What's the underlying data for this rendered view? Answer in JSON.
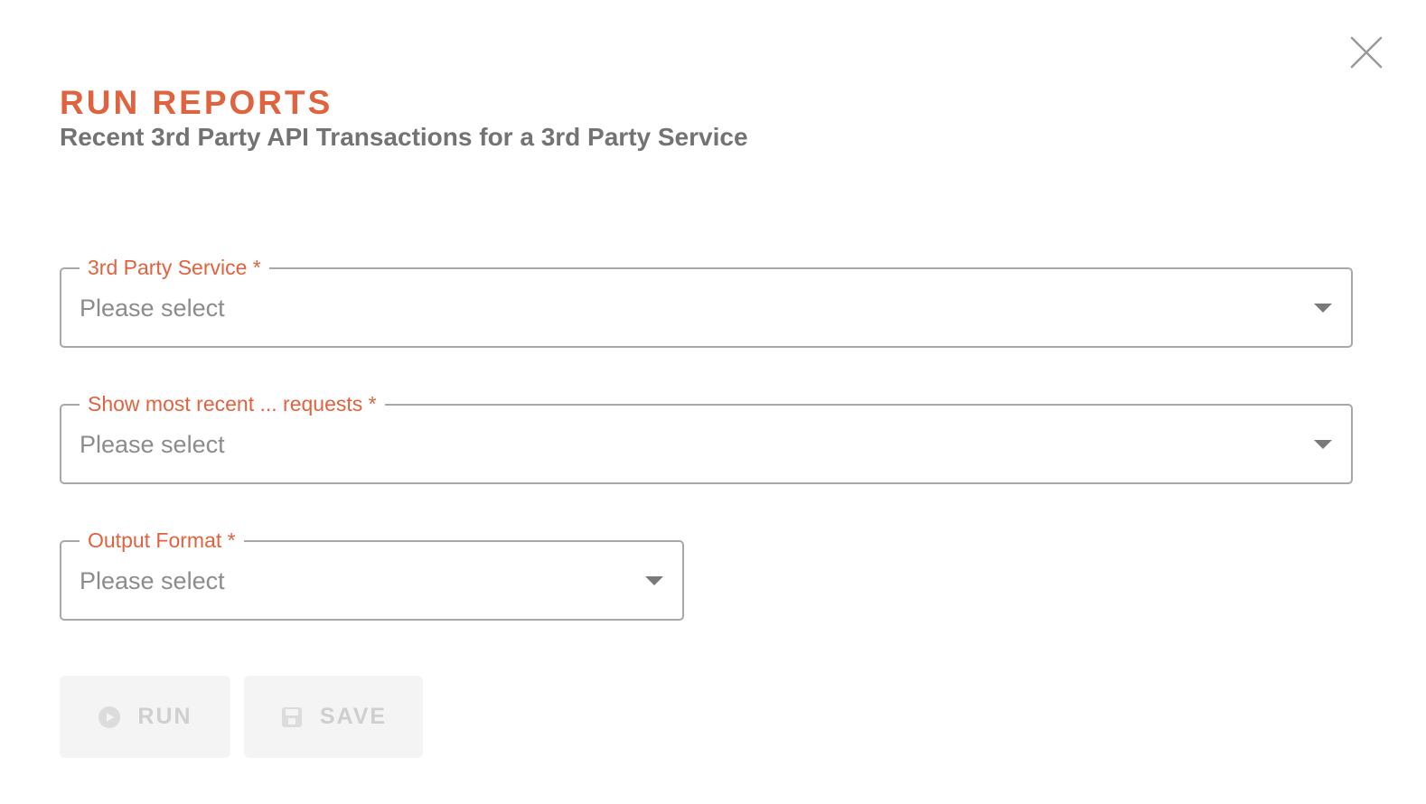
{
  "dialog": {
    "close_icon": "close-icon",
    "title": "RUN REPORTS",
    "subtitle": "Recent 3rd Party API Transactions for a 3rd Party Service"
  },
  "form": {
    "fields": [
      {
        "label": "3rd Party Service *",
        "value": "Please select",
        "icon": "chevron-down-icon"
      },
      {
        "label": "Show most recent ... requests *",
        "value": "Please select",
        "icon": "chevron-down-icon"
      },
      {
        "label": "Output Format *",
        "value": "Please select",
        "icon": "chevron-down-icon"
      }
    ]
  },
  "actions": {
    "run": {
      "label": "RUN",
      "icon": "play-icon",
      "disabled": true
    },
    "save": {
      "label": "SAVE",
      "icon": "save-icon",
      "disabled": true
    }
  },
  "colors": {
    "accent": "#e0633f",
    "subtitle": "#737373",
    "placeholder": "#8c8c8c",
    "border": "#a8a8a8",
    "button_bg": "#f4f4f4",
    "button_disabled_text": "#cfcfcf"
  }
}
